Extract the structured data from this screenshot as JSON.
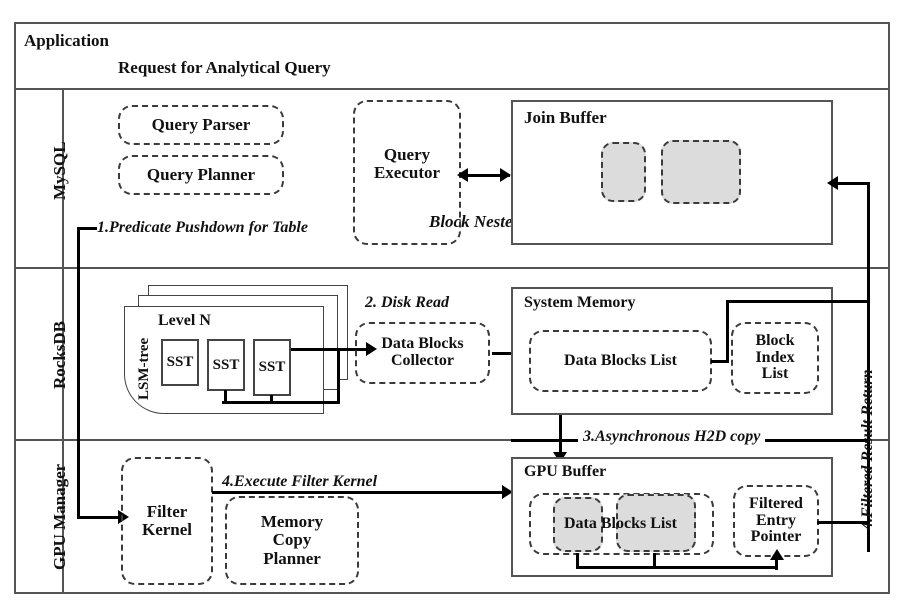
{
  "diagram": {
    "title_layer": "Application",
    "request_label": "Request for Analytical Query"
  },
  "layers": [
    {
      "id": "application",
      "name": "Application"
    },
    {
      "id": "mysql",
      "name": "MySQL"
    },
    {
      "id": "rocksdb",
      "name": "RocksDB"
    },
    {
      "id": "gpu_manager",
      "name": "GPU Manager"
    }
  ],
  "mysql": {
    "query_parser": "Query Parser",
    "query_planner": "Query Planner",
    "query_executor": "Query Executor",
    "block_nested_join": "Block Nested Join",
    "join_buffer": "Join Buffer",
    "join_buffer_blocks": [
      "",
      ""
    ]
  },
  "rocksdb": {
    "lsm_tree_label": "LSM-tree",
    "level_label": "Level N",
    "sst_blocks": [
      "SST",
      "SST",
      "SST"
    ],
    "data_blocks_collector": "Data Blocks\nCollector",
    "data_blocks_collector_line1": "Data Blocks",
    "data_blocks_collector_line2": "Collector",
    "system_memory": "System Memory",
    "data_blocks_list": "Data Blocks List",
    "block_index_list_line1": "Block",
    "block_index_list_line2": "Index",
    "block_index_list_line3": "List"
  },
  "gpu": {
    "filter_kernel_line1": "Filter",
    "filter_kernel_line2": "Kernel",
    "memory_copy_planner_line1": "Memory",
    "memory_copy_planner_line2": "Copy",
    "memory_copy_planner_line3": "Planner",
    "gpu_buffer": "GPU Buffer",
    "gpu_data_blocks_list": "Data Blocks List",
    "filtered_entry_pointer_line1": "Filtered",
    "filtered_entry_pointer_line2": "Entry",
    "filtered_entry_pointer_line3": "Pointer"
  },
  "flows": [
    {
      "id": "step1",
      "label": "1.Predicate Pushdown for Table"
    },
    {
      "id": "step2",
      "label": "2. Disk Read"
    },
    {
      "id": "step3",
      "label": "3.Asynchronous H2D copy"
    },
    {
      "id": "step4_exec",
      "label": "4.Execute Filter Kernel"
    },
    {
      "id": "step4_return",
      "label": "4.Filtered Result Return"
    }
  ],
  "colors": {
    "frame": "#555555",
    "dashed_border": "#3a3a3a",
    "grey_fill": "#dcdcdc",
    "connector": "#000000",
    "text": "#111111"
  }
}
